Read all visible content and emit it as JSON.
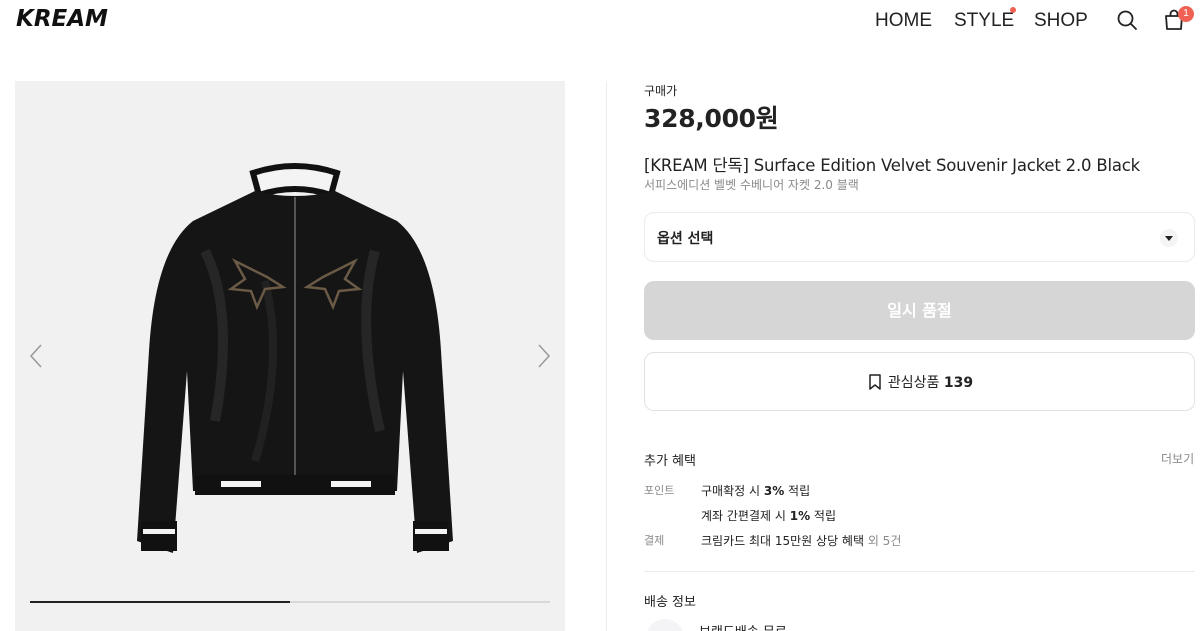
{
  "header": {
    "logo": "KREAM",
    "nav": {
      "home": "HOME",
      "style": "STYLE",
      "shop": "SHOP"
    },
    "cart_count": "1",
    "icons": {
      "search": "search-icon",
      "cart": "shopping-bag-icon"
    },
    "accent": "#ef6253"
  },
  "gallery": {
    "image": "black velvet souvenir jacket photo",
    "progress_fraction": 0.5,
    "icons": {
      "prev": "chevron-left-icon",
      "next": "chevron-right-icon"
    }
  },
  "product": {
    "price_label": "구매가",
    "price": "328,000원",
    "name": "[KREAM 단독] Surface Edition Velvet Souvenir Jacket 2.0 Black",
    "name_kr": "서피스에디션 벨벳 수베니어 자켓 2.0 블랙",
    "option_label": "옵션 선택",
    "soldout_label": "일시 품절",
    "wish_label": "관심상품",
    "wish_count": "139"
  },
  "benefits": {
    "title": "추가 혜택",
    "more": "더보기",
    "point_key": "포인트",
    "point_1": {
      "pre": "구매확정 시 ",
      "bold": "3%",
      "post": " 적립"
    },
    "point_2": {
      "pre": "계좌 간편결제 시 ",
      "bold": "1%",
      "post": " 적립"
    },
    "pay_key": "결제",
    "pay_1": {
      "pre": "크림카드 최대 15만원 상당 혜택",
      "muted": " 외 5건"
    }
  },
  "delivery": {
    "title": "배송 정보",
    "item": "브랜드배송 무료"
  }
}
